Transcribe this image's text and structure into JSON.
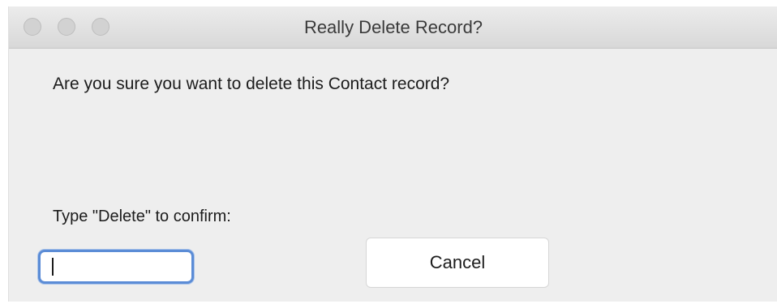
{
  "dialog": {
    "title": "Really Delete Record?",
    "message": "Are you sure you want to delete this Contact record?",
    "confirm_label": "Type \"Delete\" to confirm:",
    "confirm_input": {
      "value": "",
      "placeholder": ""
    },
    "cancel_label": "Cancel"
  },
  "window_controls": [
    "close-button",
    "minimize-button",
    "zoom-button"
  ],
  "colors": {
    "window_bg": "#eeeeee",
    "focus_ring": "#5b8cd6"
  }
}
